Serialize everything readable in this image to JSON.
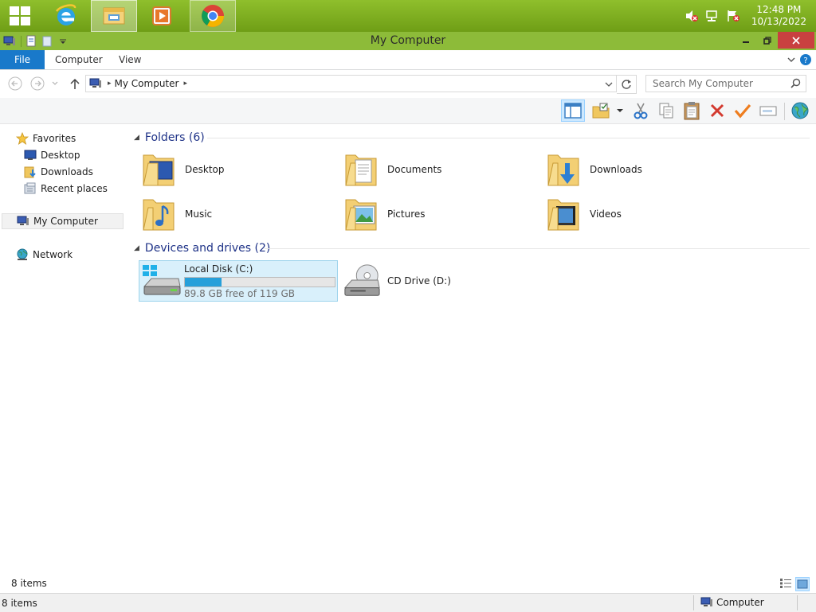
{
  "taskbar": {
    "pinned": [
      {
        "name": "internet-explorer",
        "icon": "ie-icon"
      },
      {
        "name": "file-explorer",
        "icon": "file-explorer-icon",
        "state": "active"
      },
      {
        "name": "media-player",
        "icon": "media-player-icon"
      },
      {
        "name": "chrome",
        "icon": "chrome-icon",
        "state": "hover"
      }
    ],
    "tray_icons": [
      "volume-muted-icon",
      "network-icon",
      "action-center-icon"
    ],
    "clock_time": "12:48 PM",
    "clock_date": "10/13/2022"
  },
  "window": {
    "title": "My Computer",
    "colors": {
      "titlebar": "#8dbb39",
      "accent": "#1979ca",
      "close": "#c94040",
      "taskbar": "#7aad20"
    }
  },
  "ribbon": {
    "tabs": [
      "File",
      "Computer",
      "View"
    ]
  },
  "address": {
    "path": "My Computer",
    "search_placeholder": "Search My Computer"
  },
  "toolbar": {
    "tools": [
      "preview-pane-icon",
      "properties-icon",
      "cut-icon",
      "copy-icon",
      "paste-icon",
      "delete-icon",
      "check-icon",
      "rename-icon",
      "network-globe-icon"
    ]
  },
  "nav": {
    "favorites": "Favorites",
    "desktop": "Desktop",
    "downloads": "Downloads",
    "recent": "Recent places",
    "computer": "My Computer",
    "network": "Network"
  },
  "folders": {
    "header": "Folders (6)",
    "items": [
      "Desktop",
      "Documents",
      "Downloads",
      "Music",
      "Pictures",
      "Videos"
    ]
  },
  "drives": {
    "header": "Devices and drives (2)",
    "local": {
      "name": "Local Disk (C:)",
      "free_text": "89.8 GB free of 119 GB",
      "used_fraction": 0.245
    },
    "cd": {
      "name": "CD Drive (D:)"
    }
  },
  "status": {
    "items_count": "8 items",
    "bottom_count": "8 items",
    "zone": "Computer"
  }
}
